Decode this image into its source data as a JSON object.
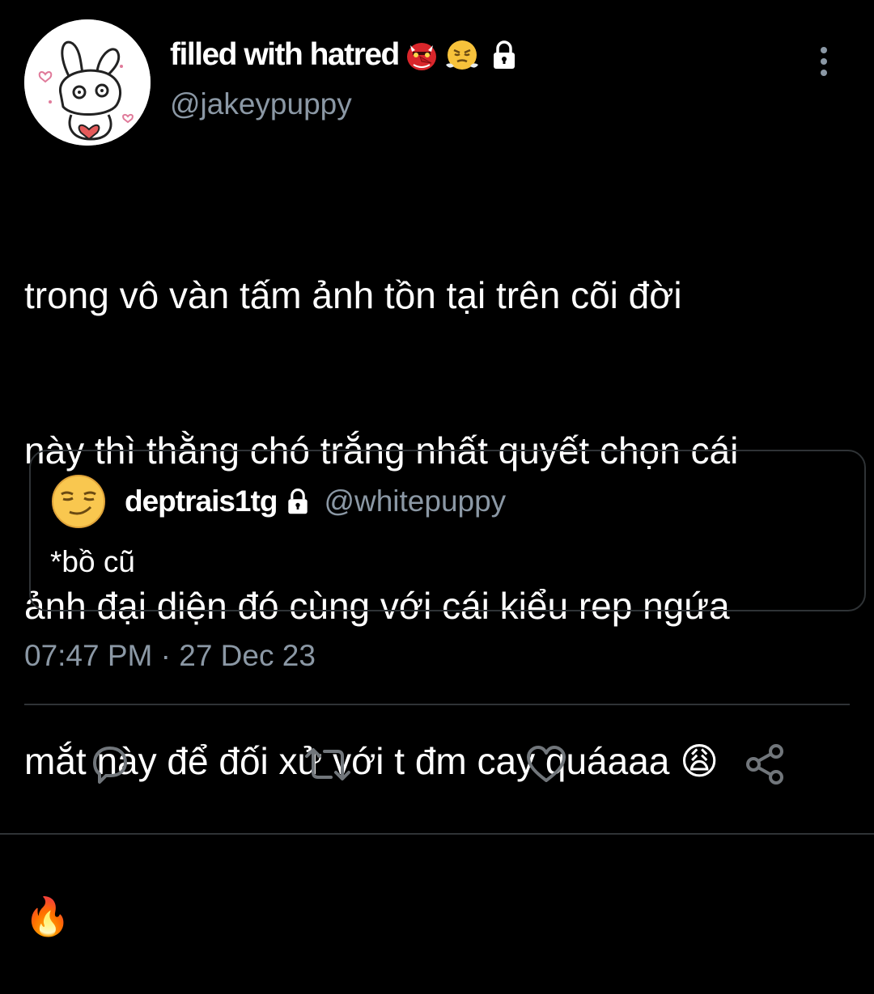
{
  "tweet": {
    "author": {
      "display_name": "filled with hatred",
      "name_emojis": [
        "👺",
        "😤"
      ],
      "handle": "@jakeypuppy",
      "protected": true
    },
    "text_lines": [
      "trong vô vàn tấm ảnh tồn tại trên cõi đời",
      "này thì thằng chó trắng nhất quyết chọn cái",
      "ảnh đại diện đó cùng với cái kiểu rep ngứa",
      "mắt này để đối xử với t đm cay quáaaa 😩",
      "🔥"
    ],
    "quoted": {
      "avatar_emoji": "😏",
      "display_name": "deptrais1tg",
      "protected": true,
      "handle": "@whitepuppy",
      "text": "*bồ cũ"
    },
    "timestamp": "07:47 PM · 27 Dec 23"
  },
  "actions": {
    "reply_icon": "reply-icon",
    "retweet_icon": "retweet-icon",
    "like_icon": "heart-icon",
    "share_icon": "share-icon"
  },
  "colors": {
    "background": "#000000",
    "primary_text": "#ffffff",
    "secondary_text": "#8b98a5",
    "border": "#2f3336",
    "icon": "#71767b"
  }
}
